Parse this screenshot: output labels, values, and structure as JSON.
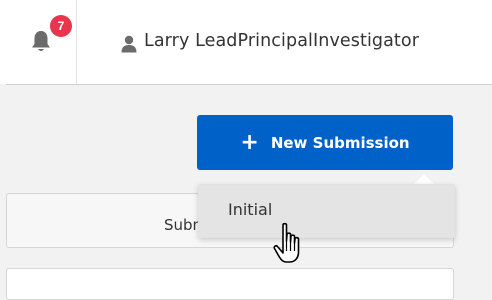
{
  "header": {
    "notifications": {
      "icon": "bell-icon",
      "count": "7"
    },
    "user": {
      "icon": "user-icon",
      "name": "Larry LeadPrincipalInvestigator"
    }
  },
  "toolbar": {
    "new_submission": {
      "icon": "plus-icon",
      "label": "New Submission"
    }
  },
  "dropdown": {
    "items": [
      {
        "label": "Initial"
      }
    ]
  },
  "panel": {
    "label": "Subm"
  },
  "colors": {
    "primary": "#0061c9",
    "badge": "#e8354d"
  }
}
